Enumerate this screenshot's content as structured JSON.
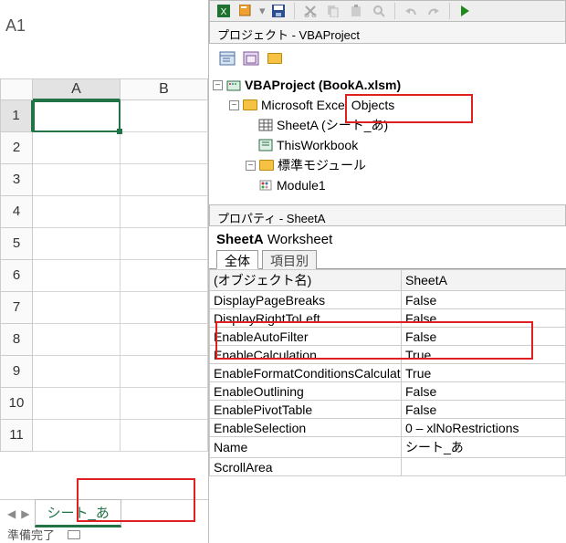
{
  "excel": {
    "name_box": "A1",
    "columns": [
      "A",
      "B"
    ],
    "rows": [
      "1",
      "2",
      "3",
      "4",
      "5",
      "6",
      "7",
      "8",
      "9",
      "10",
      "11"
    ],
    "sheet_tab": "シート_あ",
    "status": "準備完了"
  },
  "vbe": {
    "project_panel_title": "プロジェクト - VBAProject",
    "tree": {
      "root": "VBAProject (BookA.xlsm)",
      "objects_folder": "Microsoft Excel Objects",
      "sheet_item": "SheetA (シート_あ)",
      "thisworkbook": "ThisWorkbook",
      "module_folder": "標準モジュール",
      "module1": "Module1"
    },
    "properties_panel_title": "プロパティ - SheetA",
    "prop_object_name": "SheetA",
    "prop_object_type": "Worksheet",
    "tabs": {
      "all": "全体",
      "by_item": "項目別"
    },
    "props": [
      {
        "name": "(オブジェクト名)",
        "value": "SheetA"
      },
      {
        "name": "DisplayPageBreaks",
        "value": "False"
      },
      {
        "name": "DisplayRightToLeft",
        "value": "False"
      },
      {
        "name": "EnableAutoFilter",
        "value": "False"
      },
      {
        "name": "EnableCalculation",
        "value": "True"
      },
      {
        "name": "EnableFormatConditionsCalculation",
        "value": "True"
      },
      {
        "name": "EnableOutlining",
        "value": "False"
      },
      {
        "name": "EnablePivotTable",
        "value": "False"
      },
      {
        "name": "EnableSelection",
        "value": "0 – xlNoRestrictions"
      },
      {
        "name": "Name",
        "value": "シート_あ"
      },
      {
        "name": "ScrollArea",
        "value": ""
      }
    ]
  }
}
